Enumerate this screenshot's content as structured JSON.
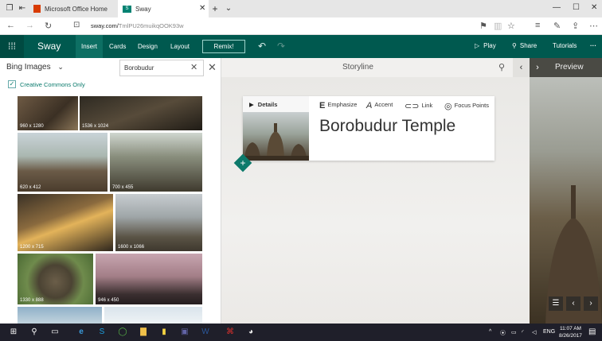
{
  "browser": {
    "tabs": [
      {
        "label": "Microsoft Office Home"
      },
      {
        "label": "Sway"
      }
    ],
    "new_tab_icon": "plus-icon",
    "url_domain": "sway.com/",
    "url_path": "TmlPU26muikqOOK93w"
  },
  "sway": {
    "app_name": "Sway",
    "menu": [
      "Insert",
      "Cards",
      "Design",
      "Layout"
    ],
    "selected_menu": "Insert",
    "remix_label": "Remix!",
    "play_label": "Play",
    "share_label": "Share",
    "tutorials_label": "Tutorials",
    "more_label": "···"
  },
  "left_panel": {
    "source": "Bing Images",
    "search_value": "Borobudur",
    "filter_label": "Creative Commons Only",
    "filter_checked": true,
    "images": [
      {
        "size": "960 x 1280"
      },
      {
        "size": "1536 x 1024"
      },
      {
        "size": "620 x 412"
      },
      {
        "size": "700 x 455"
      },
      {
        "size": "1200 x 715"
      },
      {
        "size": "1600 x 1066"
      },
      {
        "size": "1330 x 888"
      },
      {
        "size": "946 x 450"
      }
    ]
  },
  "storyline": {
    "title": "Storyline",
    "card": {
      "details_label": "Details",
      "emphasize_label": "Emphasize",
      "accent_label": "Accent",
      "link_label": "Link",
      "focus_label": "Focus Points",
      "heading": "Borobudur Temple"
    }
  },
  "preview": {
    "label": "Preview"
  },
  "taskbar": {
    "time": "11:07 AM",
    "date": "8/26/2017",
    "lang": "ENG"
  },
  "colors": {
    "sway_green": "#00594f",
    "accent_teal": "#0d7a6b",
    "taskbar": "#1f1f2a"
  }
}
